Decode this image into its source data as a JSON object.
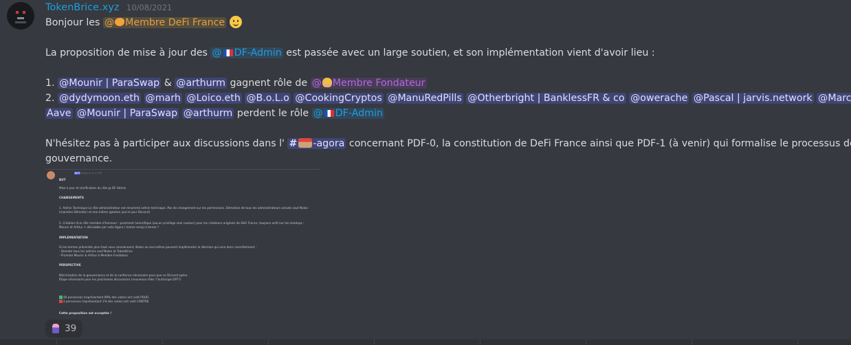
{
  "message": {
    "username": "TokenBrice.xyz",
    "timestamp": "10/08/2021",
    "greeting": {
      "text": "Bonjour les",
      "role": "@",
      "role_name": "Membre DeFi France"
    },
    "paragraph1": {
      "before": "La proposition de mise à jour des",
      "role_at": "@",
      "role_name": "DF-Admin",
      "after": "est passée avec un large soutien, et son implémentation vient d'avoir lieu :"
    },
    "item1": {
      "prefix": "1.",
      "mention1": "@Mounir | ParaSwap",
      "amp": "&",
      "mention2": "@arthurm",
      "text": "gagnent rôle de",
      "role_at": "@",
      "role_name": "Membre Fondateur"
    },
    "item2": {
      "prefix": "2.",
      "mentions_line1": [
        "@dydymoon.eth",
        "@marh",
        "@Loico.eth",
        "@B.o.L.o",
        "@CookingCryptos",
        "@ManuRedPills",
        "@Otherbright | BanklessFR & co",
        "@owerache",
        "@Pascal | jarvis.network",
        "@Marczeller |"
      ],
      "mentions_line2": [
        "Aave",
        "@Mounir | ParaSwap",
        "@arthurm"
      ],
      "text": "perdent le rôle",
      "role_at": "@",
      "role_name": "DF-Admin"
    },
    "paragraph3": {
      "before": "N'hésitez pas à participer aux discussions dans l'",
      "channel_hash": "#",
      "channel_name": "-agora",
      "after": "concernant PDF-0, la constitution de DeFi France ainsi que PDF-1 (à venir) qui formalise le processus de",
      "line2": "gouvernance."
    }
  },
  "embed": {
    "bot_badge": "BOT",
    "time": "Today at 6:31 PM",
    "name": "",
    "lines": [
      {
        "text": "BUT",
        "heading": true
      },
      {
        "text": "Mise à jour et clarification du rôle @ DF-Admin",
        "heading": false
      },
      {
        "text": "CHANGEMENTS",
        "heading": true
      },
      {
        "text": "1. Admin Technique Le rôle administrateur est renommé admin technique. Pas de changement sur les permissions. Démotion de tous les administrateurs actuels sauf Nolan",
        "heading": false
      },
      {
        "text": "(maintien Démeter) et moi-même (gestion jour-le-jour Discord)",
        "heading": false
      },
      {
        "text": "2. Création d'un rôle membre d'honneur - purement honorifique (aucun privilège seul couleur) pour les créateurs originels de DeFi France, toujours actif sur les meetups :",
        "heading": false
      },
      {
        "text": "Mounir et Arthur + décalable par vote Agora / meme emoji à terme ?",
        "heading": false
      },
      {
        "text": "IMPLÉMENTATION",
        "heading": true
      },
      {
        "text": "Si les termes présentés plus haut vous conviennent, Nolan ou moi-même peuvent implémenter la décision qui sera donc concrètement :",
        "heading": false
      },
      {
        "text": "- Demote tous les admins sauf Nolan et TokenBrice",
        "heading": false
      },
      {
        "text": "- Promote Mounir & Arthur à Membre Fondateur",
        "heading": false
      },
      {
        "text": "PERSPECTIVE",
        "heading": true
      },
      {
        "text": "Minimisation de la gouvernance et de la confiance nécessaire pour que ce Discord opère.",
        "heading": false
      },
      {
        "text": "Étape nécessaire pour les prochaines discussions (nouveaux rôles ? but/scope DFF?)",
        "heading": false
      },
      {
        "text": "48 personnes (représentant 99% des votes) ont voté POUR.",
        "heading": false,
        "mark": "check"
      },
      {
        "text": "2 personnes (représentant 1% des votes) ont voté CONTRE.",
        "heading": false,
        "mark": "cross"
      },
      {
        "text": "Cette proposition est acceptée !",
        "heading": true
      }
    ]
  },
  "reaction": {
    "icon": "lipstick-emoji-icon",
    "count": "39"
  },
  "colors": {
    "background": "#36393f",
    "username": "#1c9fdc",
    "mention_bg": "#4b4f8a",
    "role_orange": "#e0a040",
    "role_blue": "#1c9fdc",
    "role_purple": "#b367e0"
  }
}
